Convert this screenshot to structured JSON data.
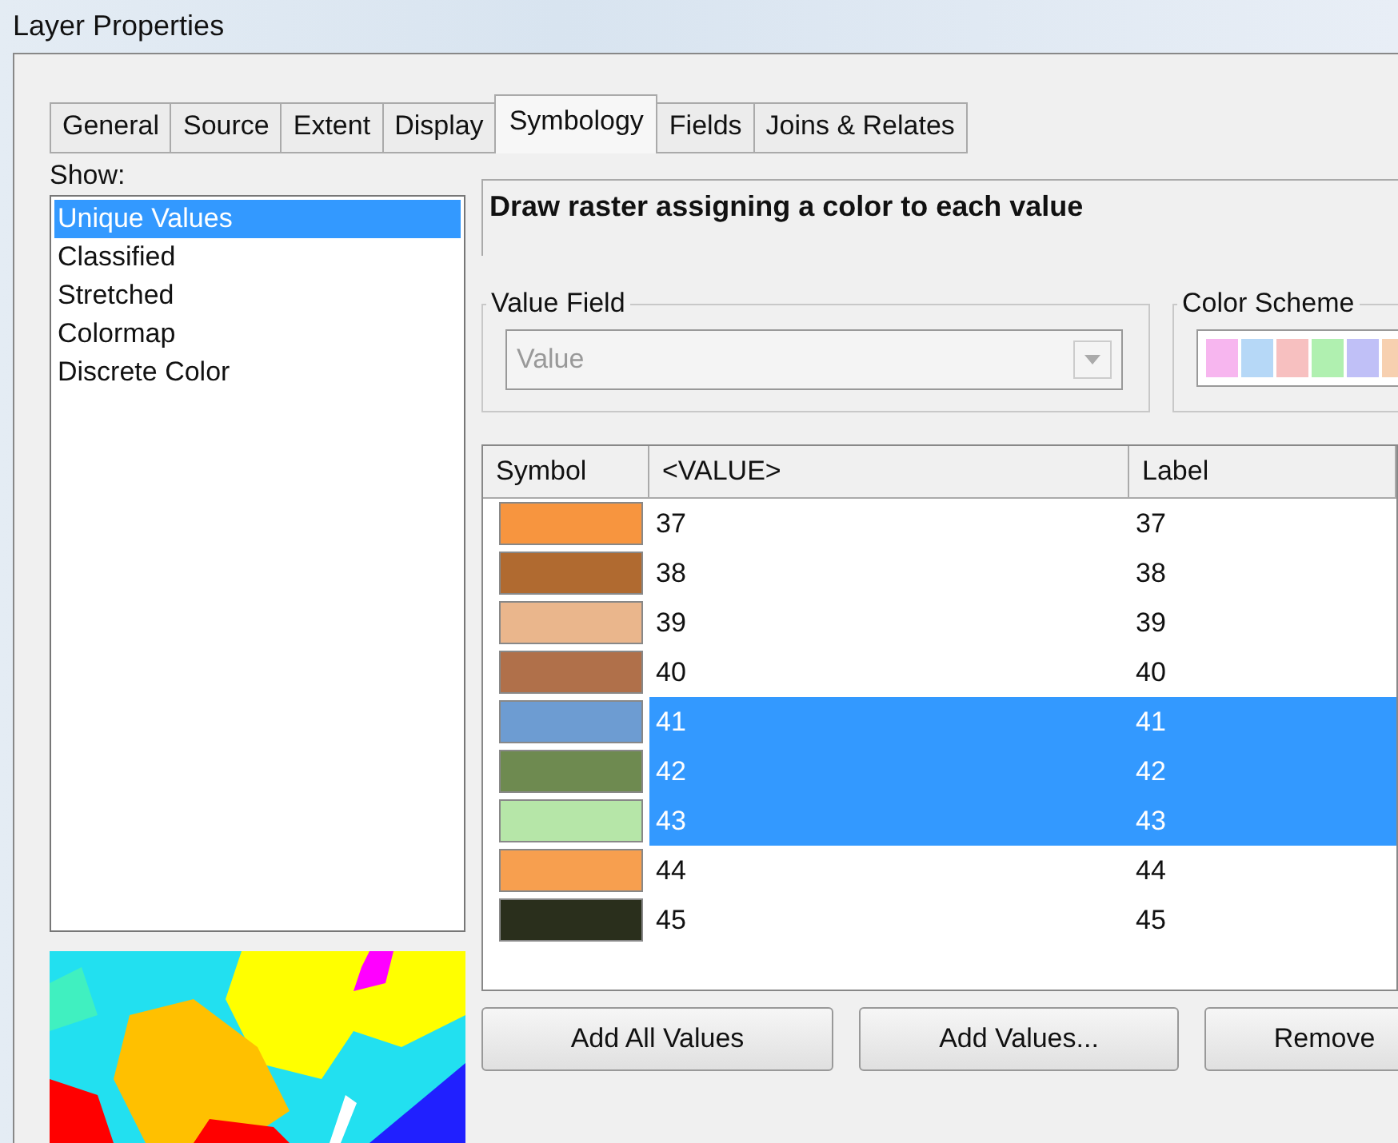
{
  "window": {
    "title": "Layer Properties"
  },
  "tabs": [
    {
      "label": "General",
      "selected": false
    },
    {
      "label": "Source",
      "selected": false
    },
    {
      "label": "Extent",
      "selected": false
    },
    {
      "label": "Display",
      "selected": false
    },
    {
      "label": "Symbology",
      "selected": true
    },
    {
      "label": "Fields",
      "selected": false
    },
    {
      "label": "Joins & Relates",
      "selected": false
    }
  ],
  "show": {
    "label": "Show:",
    "items": [
      {
        "label": "Unique Values",
        "selected": true
      },
      {
        "label": "Classified",
        "selected": false
      },
      {
        "label": "Stretched",
        "selected": false
      },
      {
        "label": "Colormap",
        "selected": false
      },
      {
        "label": "Discrete Color",
        "selected": false
      }
    ]
  },
  "heading": "Draw raster assigning a color to each value",
  "value_field": {
    "legend": "Value Field",
    "value": "Value",
    "disabled": true
  },
  "color_scheme": {
    "legend": "Color Scheme"
  },
  "table": {
    "columns": [
      "Symbol",
      "<VALUE>",
      "Label"
    ],
    "rows": [
      {
        "color": "#f7953f",
        "value": "37",
        "label": "37",
        "selected": false
      },
      {
        "color": "#b06a30",
        "value": "38",
        "label": "38",
        "selected": false
      },
      {
        "color": "#eab68c",
        "value": "39",
        "label": "39",
        "selected": false
      },
      {
        "color": "#b0704a",
        "value": "40",
        "label": "40",
        "selected": false
      },
      {
        "color": "#6d9cd2",
        "value": "41",
        "label": "41",
        "selected": true
      },
      {
        "color": "#6e8a50",
        "value": "42",
        "label": "42",
        "selected": true
      },
      {
        "color": "#b6e6a8",
        "value": "43",
        "label": "43",
        "selected": true
      },
      {
        "color": "#f79f4f",
        "value": "44",
        "label": "44",
        "selected": false
      },
      {
        "color": "#2a2f1c",
        "value": "45",
        "label": "45",
        "selected": false
      }
    ]
  },
  "buttons": [
    "Add All Values",
    "Add Values...",
    "Remove"
  ]
}
